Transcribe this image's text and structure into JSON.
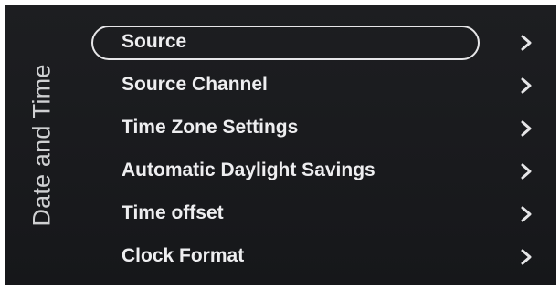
{
  "panel": {
    "title": "Date and Time"
  },
  "menu": {
    "selected_index": 0,
    "items": [
      {
        "label": "Source",
        "icon": "chevron-right-icon"
      },
      {
        "label": "Source Channel",
        "icon": "chevron-right-icon"
      },
      {
        "label": "Time Zone Settings",
        "icon": "chevron-right-icon"
      },
      {
        "label": "Automatic Daylight Savings",
        "icon": "chevron-right-icon"
      },
      {
        "label": "Time offset",
        "icon": "chevron-right-icon"
      },
      {
        "label": "Clock Format",
        "icon": "chevron-right-icon"
      }
    ]
  },
  "colors": {
    "background": "#1b1c1f",
    "text": "#eeeef0",
    "focus_ring": "#e6e6e8"
  }
}
